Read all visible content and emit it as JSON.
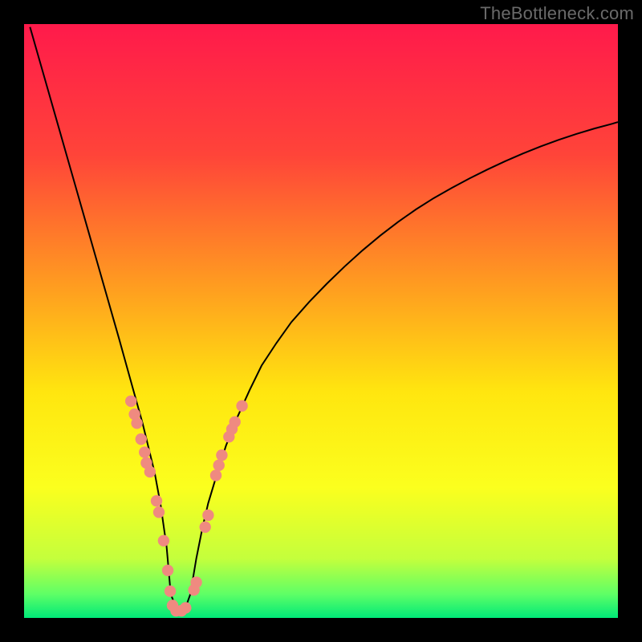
{
  "watermark": "TheBottleneck.com",
  "chart_data": {
    "type": "line",
    "title": "",
    "xlabel": "",
    "ylabel": "",
    "xlim": [
      0,
      100
    ],
    "ylim": [
      0,
      100
    ],
    "grid": false,
    "background_gradient": {
      "stops": [
        {
          "offset": 0.0,
          "color": "#ff1a4b"
        },
        {
          "offset": 0.22,
          "color": "#ff4439"
        },
        {
          "offset": 0.45,
          "color": "#ffa01f"
        },
        {
          "offset": 0.62,
          "color": "#ffe60f"
        },
        {
          "offset": 0.78,
          "color": "#fbff1e"
        },
        {
          "offset": 0.9,
          "color": "#c4ff3c"
        },
        {
          "offset": 0.96,
          "color": "#5eff66"
        },
        {
          "offset": 1.0,
          "color": "#00e978"
        }
      ]
    },
    "series": [
      {
        "name": "bottleneck-curve",
        "color": "#000000",
        "stroke_width": 2,
        "x": [
          1,
          2,
          3,
          4,
          5,
          6,
          7,
          8,
          9,
          10,
          11,
          12,
          13,
          14,
          15,
          16,
          17,
          18,
          19,
          20,
          21,
          22,
          23,
          24,
          24.7,
          25.8,
          27,
          28,
          29,
          30,
          31,
          32.5,
          34,
          36,
          38,
          40,
          42.5,
          45,
          48,
          51,
          54,
          57,
          60,
          63,
          66,
          69,
          72,
          75,
          78,
          81,
          84,
          87,
          90,
          93,
          96,
          99,
          100
        ],
        "y": [
          99.5,
          96.0,
          92.5,
          89.0,
          85.5,
          82.0,
          78.5,
          75.0,
          71.5,
          68.0,
          64.5,
          61.0,
          57.5,
          54.0,
          50.5,
          47.0,
          43.4,
          39.8,
          36.2,
          32.6,
          28.5,
          24.4,
          19.0,
          12.0,
          4.0,
          1.2,
          1.2,
          4.0,
          10.0,
          15.0,
          19.3,
          24.3,
          29.0,
          34.0,
          38.4,
          42.5,
          46.3,
          49.8,
          53.2,
          56.3,
          59.2,
          61.9,
          64.4,
          66.7,
          68.8,
          70.7,
          72.4,
          74.0,
          75.5,
          76.9,
          78.2,
          79.4,
          80.5,
          81.5,
          82.4,
          83.2,
          83.5
        ]
      }
    ],
    "scatter": {
      "name": "data-points",
      "color": "#ef8a80",
      "radius": 7.2,
      "points": [
        {
          "x": 18.0,
          "y": 36.5
        },
        {
          "x": 18.6,
          "y": 34.3
        },
        {
          "x": 19.0,
          "y": 32.8
        },
        {
          "x": 19.7,
          "y": 30.1
        },
        {
          "x": 20.3,
          "y": 27.9
        },
        {
          "x": 20.6,
          "y": 26.1
        },
        {
          "x": 21.2,
          "y": 24.6
        },
        {
          "x": 22.3,
          "y": 19.7
        },
        {
          "x": 22.7,
          "y": 17.8
        },
        {
          "x": 23.5,
          "y": 13.0
        },
        {
          "x": 24.2,
          "y": 8.0
        },
        {
          "x": 24.6,
          "y": 4.5
        },
        {
          "x": 25.0,
          "y": 2.1
        },
        {
          "x": 25.6,
          "y": 1.2
        },
        {
          "x": 26.5,
          "y": 1.2
        },
        {
          "x": 27.2,
          "y": 1.7
        },
        {
          "x": 28.6,
          "y": 4.7
        },
        {
          "x": 29.0,
          "y": 6.0
        },
        {
          "x": 30.5,
          "y": 15.3
        },
        {
          "x": 31.0,
          "y": 17.3
        },
        {
          "x": 32.3,
          "y": 24.0
        },
        {
          "x": 32.8,
          "y": 25.7
        },
        {
          "x": 33.3,
          "y": 27.4
        },
        {
          "x": 34.5,
          "y": 30.5
        },
        {
          "x": 35.0,
          "y": 31.8
        },
        {
          "x": 35.5,
          "y": 33.0
        },
        {
          "x": 36.7,
          "y": 35.7
        }
      ]
    }
  }
}
